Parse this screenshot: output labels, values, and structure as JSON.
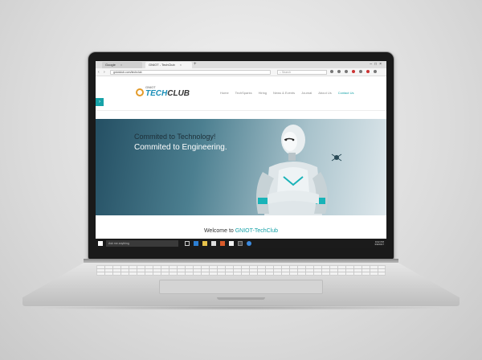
{
  "browser": {
    "tabs": [
      {
        "label": "Google"
      },
      {
        "label": "GNIOT - TechClub"
      }
    ],
    "url": "gniotclub.com/techclub",
    "search_placeholder": "Search"
  },
  "site": {
    "logo": {
      "small": "GNIOT",
      "big_a": "TECH",
      "big_b": "CLUB"
    },
    "nav": [
      "Home",
      "TechSparks",
      "Hiring",
      "News & Events",
      "Journal",
      "About Us",
      "Contact Us"
    ],
    "hero": {
      "line1": "Commited to Technology!",
      "line2": "Commited to Engineering."
    },
    "welcome_prefix": "Welcome to ",
    "welcome_name": "GNIOT-TechClub"
  },
  "taskbar": {
    "search_placeholder": "Ask me anything",
    "time": "9:02 PM",
    "date": "3/9/2017"
  },
  "colors": {
    "accent": "#17a2a8",
    "taskbar": "#1b1b1b"
  }
}
